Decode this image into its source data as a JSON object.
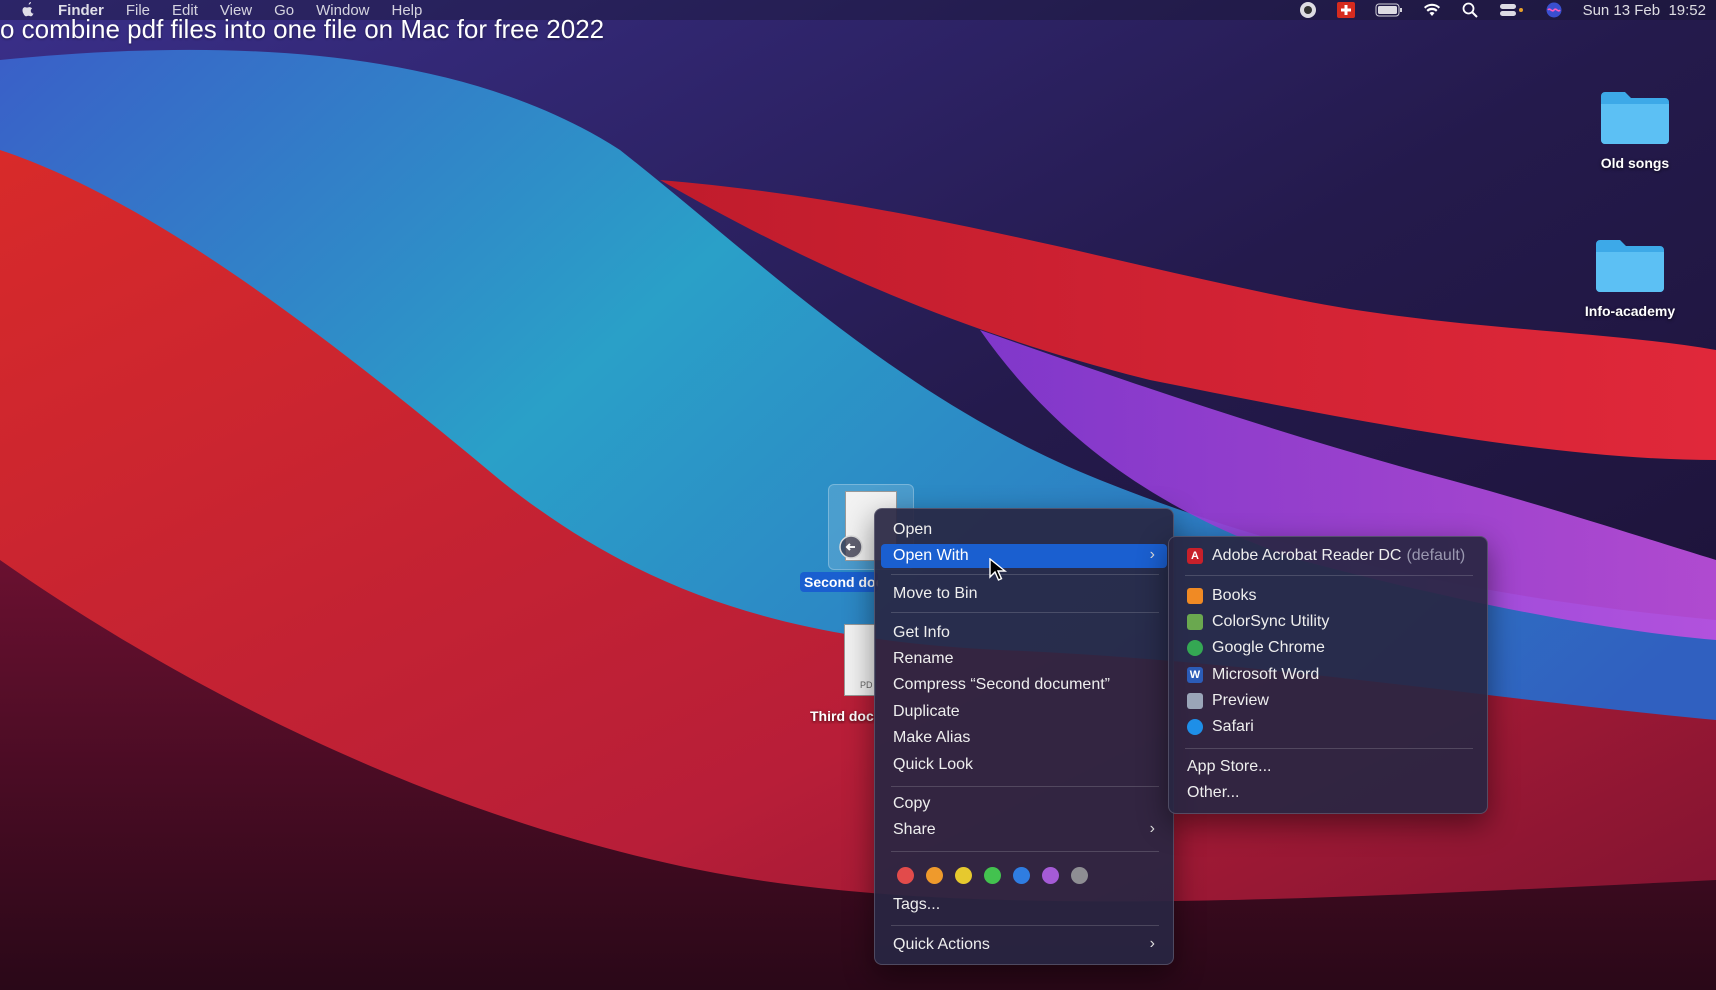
{
  "menubar": {
    "items": [
      "Finder",
      "File",
      "Edit",
      "View",
      "Go",
      "Window",
      "Help"
    ],
    "clock": "Sun 13 Feb  19:52",
    "status_icons": [
      "record-icon",
      "swiss-flag-icon",
      "battery-icon",
      "wifi-icon",
      "spotlight-icon",
      "control-center-icon",
      "siri-icon"
    ]
  },
  "headline": "o combine pdf files into one file on Mac for free 2022",
  "desktop": {
    "folders": [
      {
        "label": "Old songs"
      },
      {
        "label": "Info-academy"
      }
    ],
    "files": [
      {
        "label": "Second document",
        "selected": true
      },
      {
        "label": "Third document"
      }
    ]
  },
  "context_menu": {
    "open": "Open",
    "open_with": "Open With",
    "move_to_bin": "Move to Bin",
    "get_info": "Get Info",
    "rename": "Rename",
    "compress": "Compress “Second document”",
    "duplicate": "Duplicate",
    "make_alias": "Make Alias",
    "quick_look": "Quick Look",
    "copy": "Copy",
    "share": "Share",
    "tags_label": "Tags...",
    "quick_actions": "Quick Actions",
    "tag_colors": [
      "#e24b4b",
      "#ef9a2c",
      "#e6c92e",
      "#43c24f",
      "#2f7de1",
      "#a55bd6",
      "#8e8e93"
    ]
  },
  "open_with_menu": {
    "apps": [
      {
        "name": "Adobe Acrobat Reader DC",
        "suffix": "(default)",
        "icon": "acrobat-icon",
        "color": "#c8202a"
      },
      {
        "name": "Books",
        "icon": "books-icon",
        "color": "#f08a24"
      },
      {
        "name": "ColorSync Utility",
        "icon": "colorsync-icon",
        "color": "#6aa84f"
      },
      {
        "name": "Google Chrome",
        "icon": "chrome-icon",
        "color": "#34a853"
      },
      {
        "name": "Microsoft Word",
        "icon": "word-icon",
        "color": "#2b5cb8"
      },
      {
        "name": "Preview",
        "icon": "preview-icon",
        "color": "#9aa5b8"
      },
      {
        "name": "Safari",
        "icon": "safari-icon",
        "color": "#1e8fe8"
      }
    ],
    "app_store": "App Store...",
    "other": "Other..."
  },
  "colors": {
    "highlight": "#1a5fd0",
    "menu_bg": "#28263f"
  }
}
